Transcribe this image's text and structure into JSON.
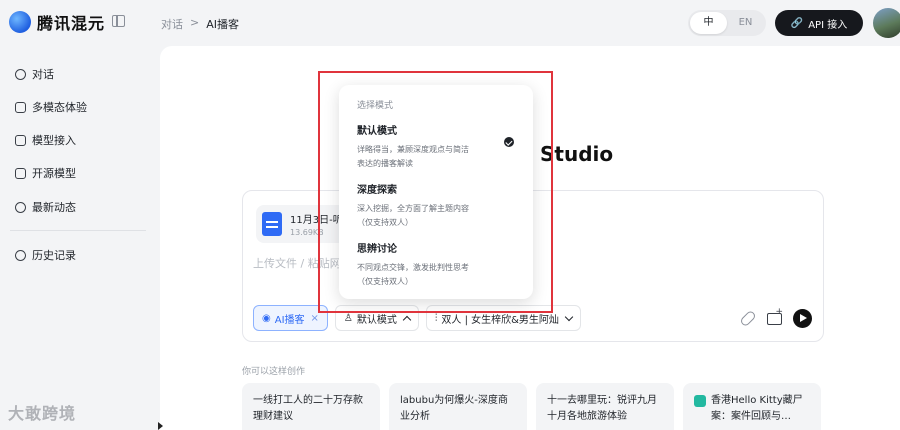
{
  "app": {
    "name": "腾讯混元"
  },
  "breadcrumb": {
    "parent": "对话",
    "separator": ">",
    "current": "AI播客"
  },
  "language": {
    "zh": "中",
    "en": "EN",
    "active": "zh"
  },
  "header": {
    "api_button": "API 接入"
  },
  "sidebar": {
    "items": [
      {
        "label": "对话",
        "icon": "chat-icon"
      },
      {
        "label": "多模态体验",
        "icon": "image-icon"
      },
      {
        "label": "模型接入",
        "icon": "puzzle-icon"
      },
      {
        "label": "开源模型",
        "icon": "shield-icon"
      },
      {
        "label": "最新动态",
        "icon": "sparkle-icon"
      }
    ],
    "history": {
      "label": "历史记录",
      "icon": "history-icon"
    }
  },
  "watermark": "大敢跨境",
  "main": {
    "hero_title": "Studio",
    "file": {
      "name": "11月3日-听",
      "size": "13.69KB"
    },
    "placeholder": "上传文件 / 粘贴网",
    "chips": {
      "podcast": "AI播客",
      "podcast_close": "×",
      "mode": "默认模式",
      "voice": "双人 | 女生梓欣&男生阿灿"
    },
    "suggest_label": "你可以这样创作",
    "suggestions": [
      {
        "line1": "一线打工人的二十万存款",
        "line2": "理财建议"
      },
      {
        "line1": "labubu为何爆火-深度商",
        "line2": "业分析"
      },
      {
        "line1": "十一去哪里玩：锐评九月",
        "line2": "十月各地旅游体验"
      },
      {
        "line1": "香港Hello Kitty藏尸",
        "line2": "案：案件回顾与…"
      }
    ]
  },
  "mode_dropdown": {
    "title": "选择模式",
    "selected": "默认模式",
    "options": [
      {
        "title": "默认模式",
        "desc1": "详略得当，兼顾深度观点与简洁",
        "desc2": "表达的播客解读"
      },
      {
        "title": "深度探索",
        "desc1": "深入挖掘，全方面了解主题内容",
        "desc2": "（仅支持双人）"
      },
      {
        "title": "思辨讨论",
        "desc1": "不同观点交锋，激发批判性思考",
        "desc2": "（仅支持双人）"
      }
    ]
  }
}
